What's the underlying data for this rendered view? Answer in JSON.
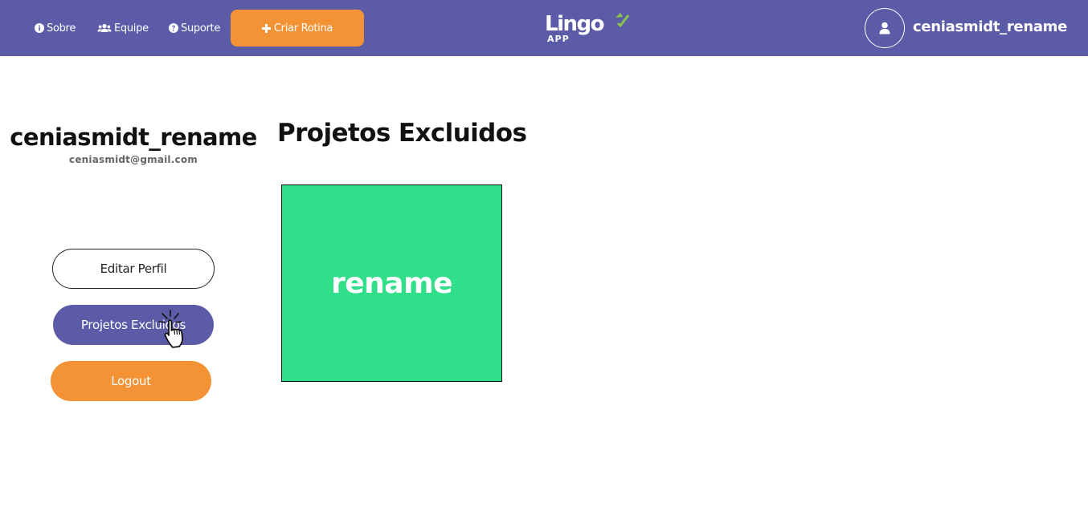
{
  "topbar": {
    "nav": [
      {
        "label": "Sobre",
        "icon": "info-circle-icon"
      },
      {
        "label": "Equipe",
        "icon": "users-icon"
      },
      {
        "label": "Suporte",
        "icon": "question-circle-icon"
      }
    ],
    "create_button": {
      "label": "Criar Rotina",
      "icon": "plus-icon"
    },
    "logo": {
      "main": "Lingo",
      "sub": "APP"
    },
    "username": "ceniasmidt_rename"
  },
  "profile": {
    "name": "ceniasmidt_rename",
    "email": "ceniasmidt@gmail.com",
    "buttons": {
      "edit": "Editar Perfil",
      "deleted_projects": "Projetos Excluidos",
      "logout": "Logout"
    }
  },
  "main": {
    "title": "Projetos Excluidos",
    "projects": [
      {
        "name": "rename"
      }
    ]
  },
  "colors": {
    "topbar": "#5b5ba8",
    "accent_orange": "#f49335",
    "project_card": "#31df8b"
  }
}
